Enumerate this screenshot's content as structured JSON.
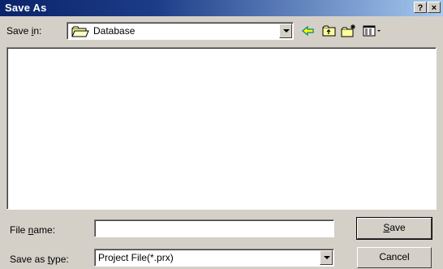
{
  "window": {
    "title": "Save As",
    "help_label": "?",
    "close_label": "×"
  },
  "save_in": {
    "label": "Save in:",
    "label_prefix": "Save ",
    "label_accel": "i",
    "label_suffix": "n:",
    "value": "Database"
  },
  "toolbar": {
    "icons": [
      "back-icon",
      "up-folder-icon",
      "new-folder-icon",
      "view-menu-icon"
    ]
  },
  "file_name": {
    "label_prefix": "File ",
    "label_accel": "n",
    "label_suffix": "ame:",
    "value": ""
  },
  "file_type": {
    "label_prefix": "Save as ",
    "label_accel": "t",
    "label_suffix": "ype:",
    "value": "Project File(*.prx)"
  },
  "buttons": {
    "save_prefix": "",
    "save_accel": "S",
    "save_suffix": "ave",
    "cancel": "Cancel"
  },
  "colors": {
    "titlebar_start": "#0a246a",
    "titlebar_end": "#a6caf0",
    "face": "#d4d0c8"
  }
}
